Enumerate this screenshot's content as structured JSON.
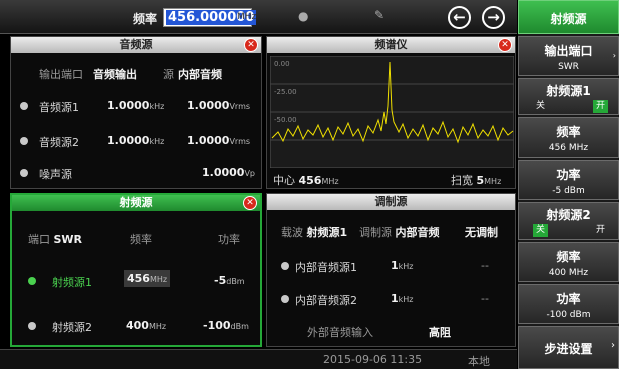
{
  "topbar": {
    "freq_label": "频率",
    "freq_value": "456.000000",
    "freq_unit": "MHz"
  },
  "audio_panel": {
    "title": "音频源",
    "output_port_label": "输出端口",
    "output_port_value": "音频输出",
    "source_label": "源",
    "source_value": "内部音频",
    "rows": [
      {
        "name": "音频源1",
        "freq": "1.0000",
        "freq_unit": "kHz",
        "amp": "1.0000",
        "amp_unit": "Vrms"
      },
      {
        "name": "音频源2",
        "freq": "1.0000",
        "freq_unit": "kHz",
        "amp": "1.0000",
        "amp_unit": "Vrms"
      }
    ],
    "noise": {
      "name": "噪声源",
      "amp": "1.0000",
      "amp_unit": "Vp"
    }
  },
  "spectrum": {
    "title": "频谱仪",
    "ref_levels": [
      "0.00",
      "-25.00",
      "-50.00"
    ],
    "center_label": "中心",
    "center_value": "456",
    "center_unit": "MHz",
    "span_label": "扫宽",
    "span_value": "5",
    "span_unit": "MHz"
  },
  "rf_panel": {
    "title": "射频源",
    "port_label": "端口",
    "port_value": "SWR",
    "col_freq": "频率",
    "col_power": "功率",
    "rows": [
      {
        "name": "射频源1",
        "freq": "456",
        "freq_unit": "MHz",
        "power": "-5",
        "power_unit": "dBm",
        "active": true
      },
      {
        "name": "射频源2",
        "freq": "400",
        "freq_unit": "MHz",
        "power": "-100",
        "power_unit": "dBm",
        "active": false
      }
    ]
  },
  "mod_panel": {
    "title": "调制源",
    "carrier_label": "载波",
    "carrier_value": "射频源1",
    "modsrc_label": "调制源",
    "modsrc_value": "内部音频",
    "mode_value": "无调制",
    "rows": [
      {
        "name": "内部音频源1",
        "freq": "1",
        "freq_unit": "kHz",
        "extra": "--"
      },
      {
        "name": "内部音频源2",
        "freq": "1",
        "freq_unit": "kHz",
        "extra": "--"
      }
    ],
    "ext_label": "外部音频输入",
    "ext_value": "高阻"
  },
  "status": {
    "datetime": "2015-09-06 11:35",
    "mode": "本地"
  },
  "sidebar": {
    "header": "射频源",
    "port": {
      "title": "输出端口",
      "value": "SWR"
    },
    "src1": {
      "title": "射频源1",
      "off": "关",
      "on": "开"
    },
    "freq1": {
      "title": "频率",
      "value": "456 MHz"
    },
    "pow1": {
      "title": "功率",
      "value": "-5 dBm"
    },
    "src2": {
      "title": "射频源2",
      "on": "关",
      "off": "开"
    },
    "freq2": {
      "title": "频率",
      "value": "400 MHz"
    },
    "pow2": {
      "title": "功率",
      "value": "-100 dBm"
    },
    "step": {
      "title": "步进设置"
    }
  },
  "colors": {
    "accent_green": "#25a838",
    "trace": "#f0e000",
    "close_red": "#d8291c",
    "focus_blue": "#2356d6"
  }
}
